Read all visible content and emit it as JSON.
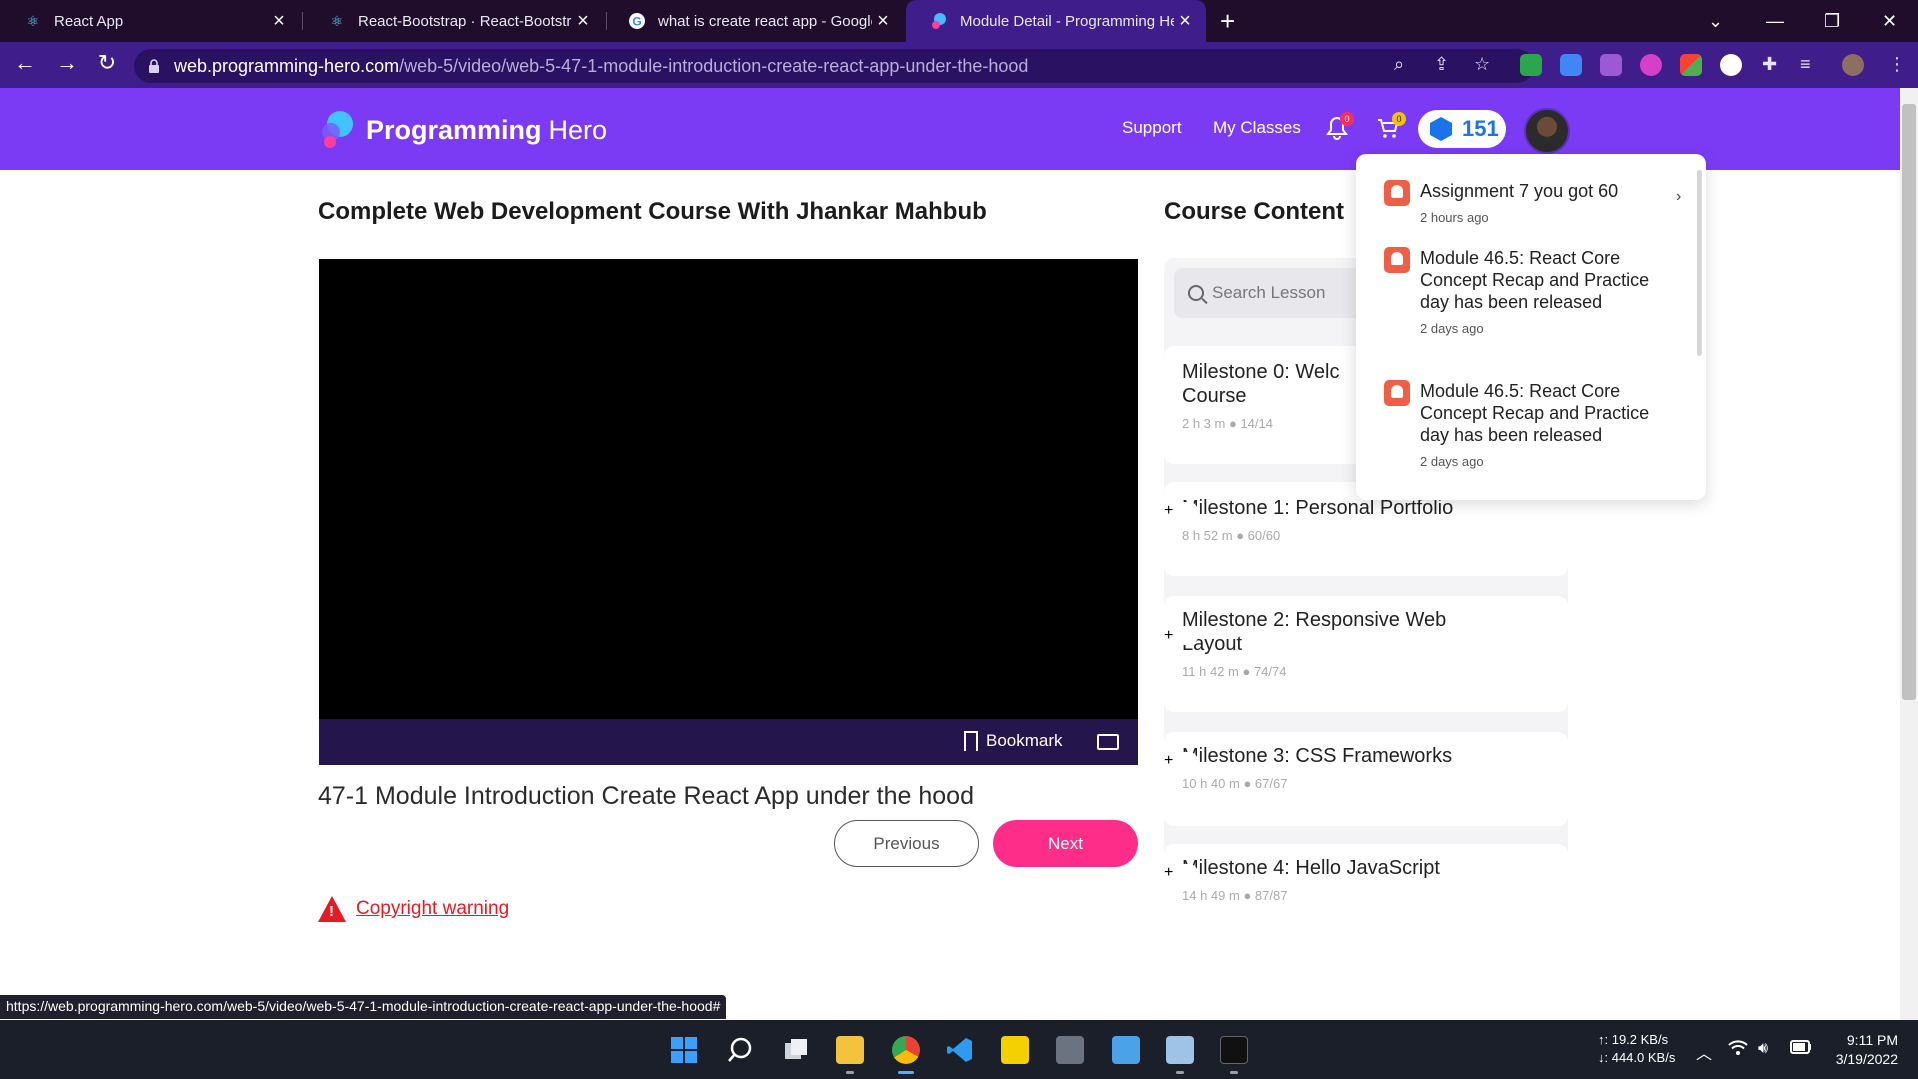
{
  "browser": {
    "tabs": [
      {
        "title": "React App",
        "icon": "react-icon",
        "active": false
      },
      {
        "title": "React-Bootstrap · React-Bootstrap",
        "icon": "react-bootstrap-icon",
        "active": false
      },
      {
        "title": "what is create react app - Google",
        "icon": "google-icon",
        "active": false
      },
      {
        "title": "Module Detail - Programming Hero",
        "icon": "programming-hero-icon",
        "active": true
      }
    ],
    "url_host": "web.programming-hero.com",
    "url_path": "/web-5/video/web-5-47-1-module-introduction-create-react-app-under-the-hood",
    "status_url": "https://web.programming-hero.com/web-5/video/web-5-47-1-module-introduction-create-react-app-under-the-hood#"
  },
  "header": {
    "logo_bold": "Programming",
    "logo_light": "Hero",
    "nav": [
      "Support",
      "My Classes"
    ],
    "notification_count": "0",
    "cart_count": "0",
    "gems": "151",
    "brand_color": "#7b3bf5"
  },
  "main": {
    "course_title": "Complete Web Development Course With Jhankar Mahbub",
    "bookmark_label": "Bookmark",
    "lesson_title": "47-1 Module Introduction Create React App under the hood",
    "previous_label": "Previous",
    "next_label": "Next",
    "copyright_label": "Copyright warning",
    "accent_color": "#ff2d8a"
  },
  "sidebar": {
    "title": "Course Content",
    "search_placeholder": "Search Lesson",
    "milestones": [
      {
        "title": "Milestone 0: Welcome Course",
        "shown_title_line1": "Milestone 0: Welc",
        "shown_title_line2": "Course",
        "duration": "2 h 3 m",
        "progress": "14/14"
      },
      {
        "title": "Milestone 1: Personal Portfolio",
        "duration": "8 h 52 m",
        "progress": "60/60"
      },
      {
        "title": "Milestone 2: Responsive Web Layout",
        "duration": "11 h 42 m",
        "progress": "74/74"
      },
      {
        "title": "Milestone 3: CSS Frameworks",
        "duration": "10 h 40 m",
        "progress": "67/67"
      },
      {
        "title": "Milestone 4: Hello JavaScript",
        "duration": "14 h 49 m",
        "progress": "87/87"
      }
    ],
    "plus_label": "+"
  },
  "notifications": [
    {
      "message": "Assignment 7 you got 60",
      "time": "2 hours ago"
    },
    {
      "message": "Module 46.5: React Core Concept Recap and Practice day has been released",
      "time": "2 days ago"
    },
    {
      "message": "Module 46.5: React Core Concept Recap and Practice day has been released",
      "time": "2 days ago"
    }
  ],
  "taskbar": {
    "upload": "↑: 19.2 KB/s",
    "download": "↓: 444.0 KB/s",
    "time": "9:11 PM",
    "date": "3/19/2022"
  }
}
